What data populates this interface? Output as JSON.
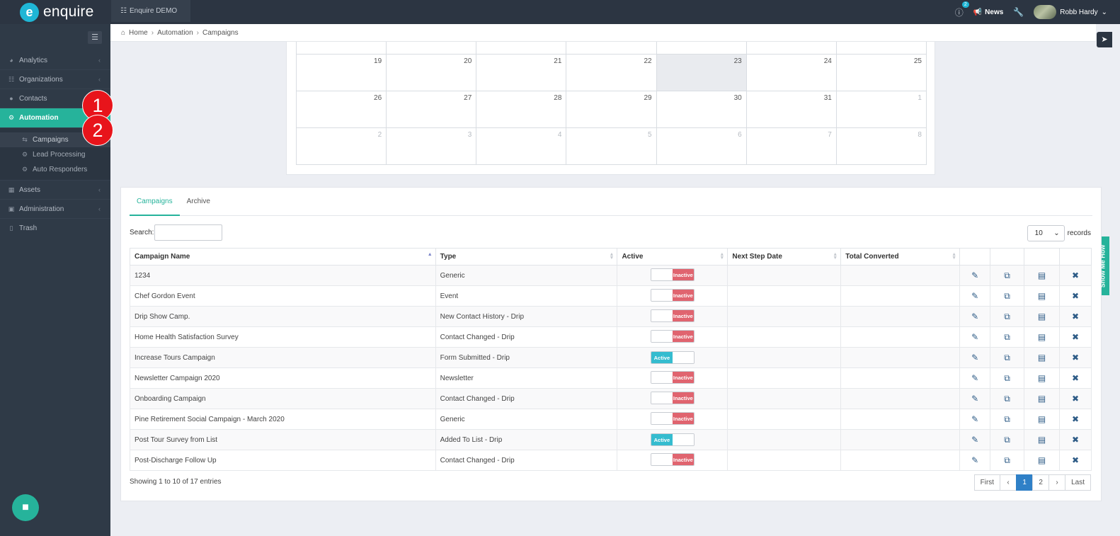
{
  "app": {
    "logo_text": "enquire",
    "logo_mark": "e",
    "env_tab": "Enquire DEMO",
    "notif_count": "2",
    "news_label": "News",
    "user_name": "Robb Hardy"
  },
  "sidebar": {
    "items": [
      {
        "label": "Analytics"
      },
      {
        "label": "Organizations"
      },
      {
        "label": "Contacts"
      },
      {
        "label": "Automation"
      },
      {
        "label": "Assets"
      },
      {
        "label": "Administration"
      },
      {
        "label": "Trash"
      }
    ],
    "sub_items": [
      {
        "label": "Campaigns"
      },
      {
        "label": "Lead Processing"
      },
      {
        "label": "Auto Responders"
      }
    ]
  },
  "steps": [
    "1",
    "2"
  ],
  "breadcrumb": [
    "Home",
    "Automation",
    "Campaigns"
  ],
  "show_me_how": "Show Me How",
  "calendar": {
    "weeks": [
      [
        "19",
        "20",
        "21",
        "22",
        "23",
        "24",
        "25"
      ],
      [
        "26",
        "27",
        "28",
        "29",
        "30",
        "31",
        "1"
      ],
      [
        "2",
        "3",
        "4",
        "5",
        "6",
        "7",
        "8"
      ]
    ]
  },
  "tabs": [
    "Campaigns",
    "Archive"
  ],
  "search": {
    "label": "Search:",
    "value": ""
  },
  "records": {
    "value": "10",
    "label": "records"
  },
  "table": {
    "columns": [
      "Campaign Name",
      "Type",
      "Active",
      "Next Step Date",
      "Total Converted"
    ],
    "rows": [
      {
        "name": "1234",
        "type": "Generic",
        "active": false
      },
      {
        "name": "Chef Gordon Event",
        "type": "Event",
        "active": false
      },
      {
        "name": "Drip Show Camp.",
        "type": "New Contact History - Drip",
        "active": false
      },
      {
        "name": "Home Health Satisfaction Survey",
        "type": "Contact Changed - Drip",
        "active": false
      },
      {
        "name": "Increase Tours Campaign",
        "type": "Form Submitted - Drip",
        "active": true
      },
      {
        "name": "Newsletter Campaign 2020",
        "type": "Newsletter",
        "active": false
      },
      {
        "name": "Onboarding Campaign",
        "type": "Contact Changed - Drip",
        "active": false
      },
      {
        "name": "Pine Retirement Social Campaign - March 2020",
        "type": "Generic",
        "active": false
      },
      {
        "name": "Post Tour Survey from List",
        "type": "Added To List - Drip",
        "active": true
      },
      {
        "name": "Post-Discharge Follow Up",
        "type": "Contact Changed - Drip",
        "active": false
      }
    ],
    "active_label": "Active",
    "inactive_label": "Inactive"
  },
  "info": "Showing 1 to 10 of 17 entries",
  "pager": {
    "first": "First",
    "prev": "‹",
    "pages": [
      "1",
      "2"
    ],
    "next": "›",
    "last": "Last",
    "current": "1"
  },
  "colors": {
    "accent": "#26b39b",
    "sidebar": "#2f3a47",
    "topbar": "#2c3542",
    "inactive": "#e0646f",
    "active": "#35bccf",
    "step_marker": "#e8141b"
  }
}
